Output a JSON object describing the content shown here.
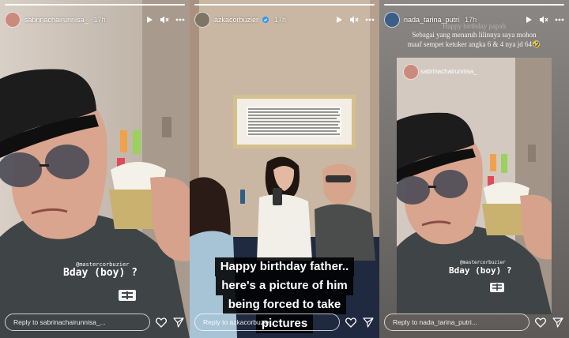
{
  "stories": [
    {
      "username": "sabrinachairunnisa_",
      "time": "17h",
      "mention": "@mastercorbuzier",
      "sticker_text": "Bday (boy) ?",
      "reply_placeholder": "Reply to sabrinachairunnisa_..."
    },
    {
      "username": "azkacorbuzier",
      "time": "17h",
      "caption_lines": [
        "Happy birthday father..",
        "here's a picture of him",
        "being forced to take",
        "pictures"
      ],
      "reply_placeholder": "Reply to azkacorbuzier..."
    },
    {
      "username": "nada_tarina_putri",
      "time": "17h",
      "overlay_text_faint": "Happy birthday papah",
      "overlay_text_line1": "Sebagai yang menaruh lilinnya saya mohon",
      "overlay_text_line2": "maaf sempet ketuker angka 6 & 4 nya jd 64",
      "overlay_emoji": "🤣",
      "inner_username": "sabrinachairunnisa_",
      "inner_mention": "@mastercorbuzier",
      "inner_sticker_text": "Bday (boy) ?",
      "reply_placeholder": "Reply to nada_tarina_putri..."
    }
  ],
  "colors": {
    "wall_warm": "#c9b7a3",
    "text_white": "#ffffff"
  }
}
